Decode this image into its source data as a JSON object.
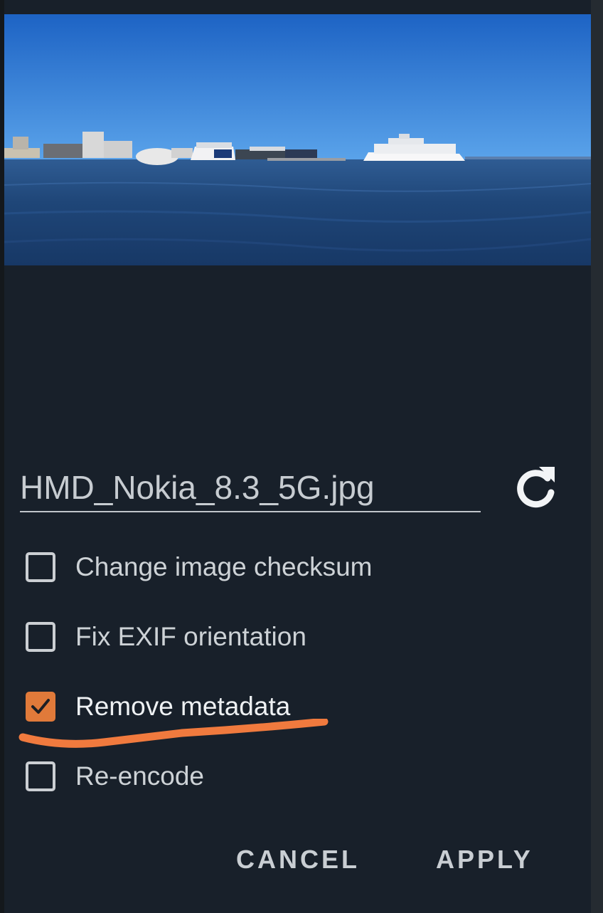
{
  "dialog": {
    "filename": "HMD_Nokia_8.3_5G.jpg",
    "refresh_icon": "refresh-icon",
    "options": [
      {
        "label": "Change image checksum",
        "checked": false
      },
      {
        "label": "Fix EXIF orientation",
        "checked": false
      },
      {
        "label": "Remove metadata",
        "checked": true
      },
      {
        "label": "Re-encode",
        "checked": false
      }
    ],
    "cancel_label": "CANCEL",
    "apply_label": "APPLY"
  },
  "colors": {
    "accent": "#e07a3a",
    "dialog_bg": "#18202a",
    "scribble": "#f07a3e"
  }
}
